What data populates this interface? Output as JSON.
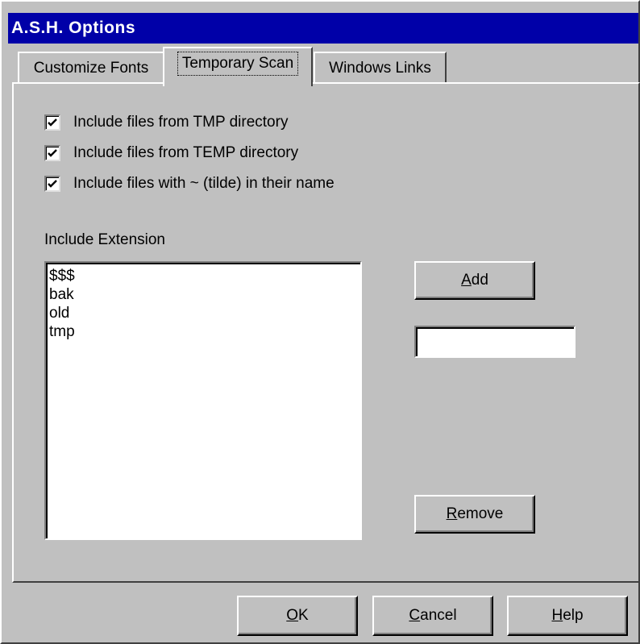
{
  "window": {
    "title": "A.S.H. Options"
  },
  "tabs": [
    {
      "label": "Customize Fonts",
      "active": false
    },
    {
      "label": "Temporary Scan",
      "active": true
    },
    {
      "label": "Windows Links",
      "active": false
    }
  ],
  "options": [
    {
      "label": "Include files from TMP directory",
      "checked": true
    },
    {
      "label": "Include files from TEMP directory",
      "checked": true
    },
    {
      "label": "Include files with ~ (tilde) in their name",
      "checked": true
    }
  ],
  "extensions": {
    "label": "Include Extension",
    "items": [
      "$$$",
      "bak",
      "old",
      "tmp"
    ],
    "new_value": ""
  },
  "buttons": {
    "add": {
      "mnemonic": "A",
      "rest": "dd"
    },
    "remove": {
      "mnemonic": "R",
      "rest": "emove"
    },
    "ok": {
      "mnemonic": "O",
      "rest": "K"
    },
    "cancel": {
      "mnemonic": "C",
      "rest": "ancel"
    },
    "help": {
      "mnemonic": "H",
      "rest": "elp"
    }
  }
}
